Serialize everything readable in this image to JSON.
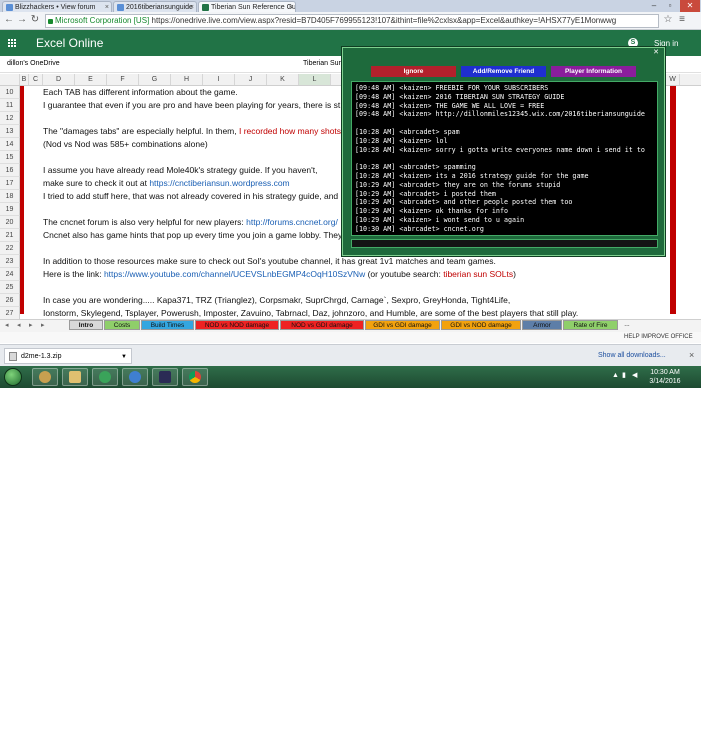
{
  "browser": {
    "tabs": [
      {
        "label": "Blizzhackers • View forum"
      },
      {
        "label": "2016tiberiansunguide"
      },
      {
        "label": "Tiberian Sun Reference Gu"
      }
    ],
    "url_org": "Microsoft Corporation [US]",
    "url": "https://onedrive.live.com/view.aspx?resid=B7D405F769955123!107&ithint=file%2cxlsx&app=Excel&authkey=!AHSX77yE1Monwwg"
  },
  "excel": {
    "app_title": "Excel Online",
    "sign_in": "Sign in",
    "breadcrumb": "dillon's OneDrive",
    "doc_title": "Tiberian Sun R",
    "columns": [
      "B",
      "C",
      "D",
      "E",
      "F",
      "G",
      "H",
      "I",
      "J",
      "K",
      "L",
      "W"
    ],
    "rows": [
      {
        "num": "10",
        "text": "Each TAB has different information about the game."
      },
      {
        "num": "11",
        "text": "I guarantee that even if you are pro and have been playing for years, there is st"
      },
      {
        "num": "12",
        "text": ""
      },
      {
        "num": "13",
        "pre": "The \"damages tabs\" are especially helpful. In them, ",
        "red": "I recorded how many shots it"
      },
      {
        "num": "14",
        "text": "(Nod vs Nod was 585+ combinations alone)"
      },
      {
        "num": "15",
        "text": ""
      },
      {
        "num": "16",
        "text": "I assume you have already read Mole40k's strategy guide. If you haven't,"
      },
      {
        "num": "17",
        "pre": "make sure to check it out at  ",
        "blue": "https://cnctiberiansun.wordpress.com"
      },
      {
        "num": "18",
        "text": "I tried to add stuff here, that was not already covered in his strategy guide, and if s"
      },
      {
        "num": "19",
        "text": ""
      },
      {
        "num": "20",
        "pre": "The cncnet forum is also very helpful for new players:  ",
        "blue": "http://forums.cncnet.org/"
      },
      {
        "num": "21",
        "text": "Cncnet also has game hints that pop up every time you join a game lobby. They ca"
      },
      {
        "num": "22",
        "text": ""
      },
      {
        "num": "23",
        "text": "In addition to those resources make sure to check out SoI's youtube channel, it has great 1v1 matches and team games."
      },
      {
        "num": "24",
        "pre": "Here is the link:  ",
        "blue": "https://www.youtube.com/channel/UCEVSLnbEGMP4cOqH10SzVNw",
        "post": "  (or youtube search: ",
        "red": "tiberian sun SOLts",
        "tail": ")"
      },
      {
        "num": "25",
        "text": ""
      },
      {
        "num": "26",
        "text": "In case you are wondering.....   Kapa371, TRZ (Trianglez), Corpsmakr, SuprChrgd, Carnage`, Sexpro, GreyHonda, Tight4Life,"
      },
      {
        "num": "27",
        "text": "Ionstorm, Skylegend, Tsplayer, Powerush, Imposter, Zavuino, Tabrnacl, Daz, johnzoro, and Humble, are some of the best players that still play."
      }
    ],
    "sheet_tabs": [
      {
        "label": "Intro",
        "color": "#d9d9d9"
      },
      {
        "label": "Costs",
        "color": "#8fcf6a"
      },
      {
        "label": "Build Times",
        "color": "#33a6e0"
      },
      {
        "label": "NOD vs NOD damage",
        "color": "#ee2222"
      },
      {
        "label": "NOD vs GDI damage",
        "color": "#ee2222"
      },
      {
        "label": "GDI vs GDI damage",
        "color": "#f2a20e"
      },
      {
        "label": "GDI vs NOD damage",
        "color": "#f2a20e"
      },
      {
        "label": "Armor",
        "color": "#5d7ea8"
      },
      {
        "label": "Rate of Fire",
        "color": "#8fcf6a"
      },
      {
        "label": "...",
        "color": "#f3f3f3"
      }
    ],
    "status_right": "HELP IMPROVE OFFICE"
  },
  "downloads": {
    "file": "d2me-1.3.zip",
    "show_all": "Show all downloads..."
  },
  "taskbar": {
    "time": "10:30 AM",
    "date": "3/14/2016"
  },
  "chat": {
    "title": "",
    "buttons": [
      {
        "label": "Ignore",
        "color": "#b3202c"
      },
      {
        "label": "Add/Remove Friend",
        "color": "#1f2fd0"
      },
      {
        "label": "Player Information",
        "color": "#8a1d9c"
      }
    ],
    "lines": [
      "[09:48 AM] <kaizen> FREEBIE FOR YOUR SUBSCRIBERS",
      "[09:48 AM] <kaizen> 2016 TIBERIAN SUN STRATEGY GUIDE",
      "[09:48 AM] <kaizen> THE GAME WE ALL LOVE = FREE",
      "[09:48 AM] <kaizen> http://dillonmiles12345.wix.com/2016tiberiansunguide",
      "",
      "[10:28 AM] <abrcadet> spam",
      "[10:28 AM] <kaizen> lol",
      "[10:28 AM] <kaizen> sorry  i gotta write everyones name down i send it to",
      "",
      "[10:28 AM] <abrcadet> spamming",
      "[10:28 AM] <kaizen> its a 2016 strategy guide for the game",
      "[10:29 AM] <abrcadet> they are on the forums stupid",
      "[10:29 AM] <abrcadet> i posted them",
      "[10:29 AM] <abrcadet> and other people posted them too",
      "[10:29 AM] <kaizen> ok thanks for info",
      "[10:29 AM] <kaizen> i wont send to u again",
      "[10:30 AM] <abrcadet> cncnet.org"
    ]
  }
}
